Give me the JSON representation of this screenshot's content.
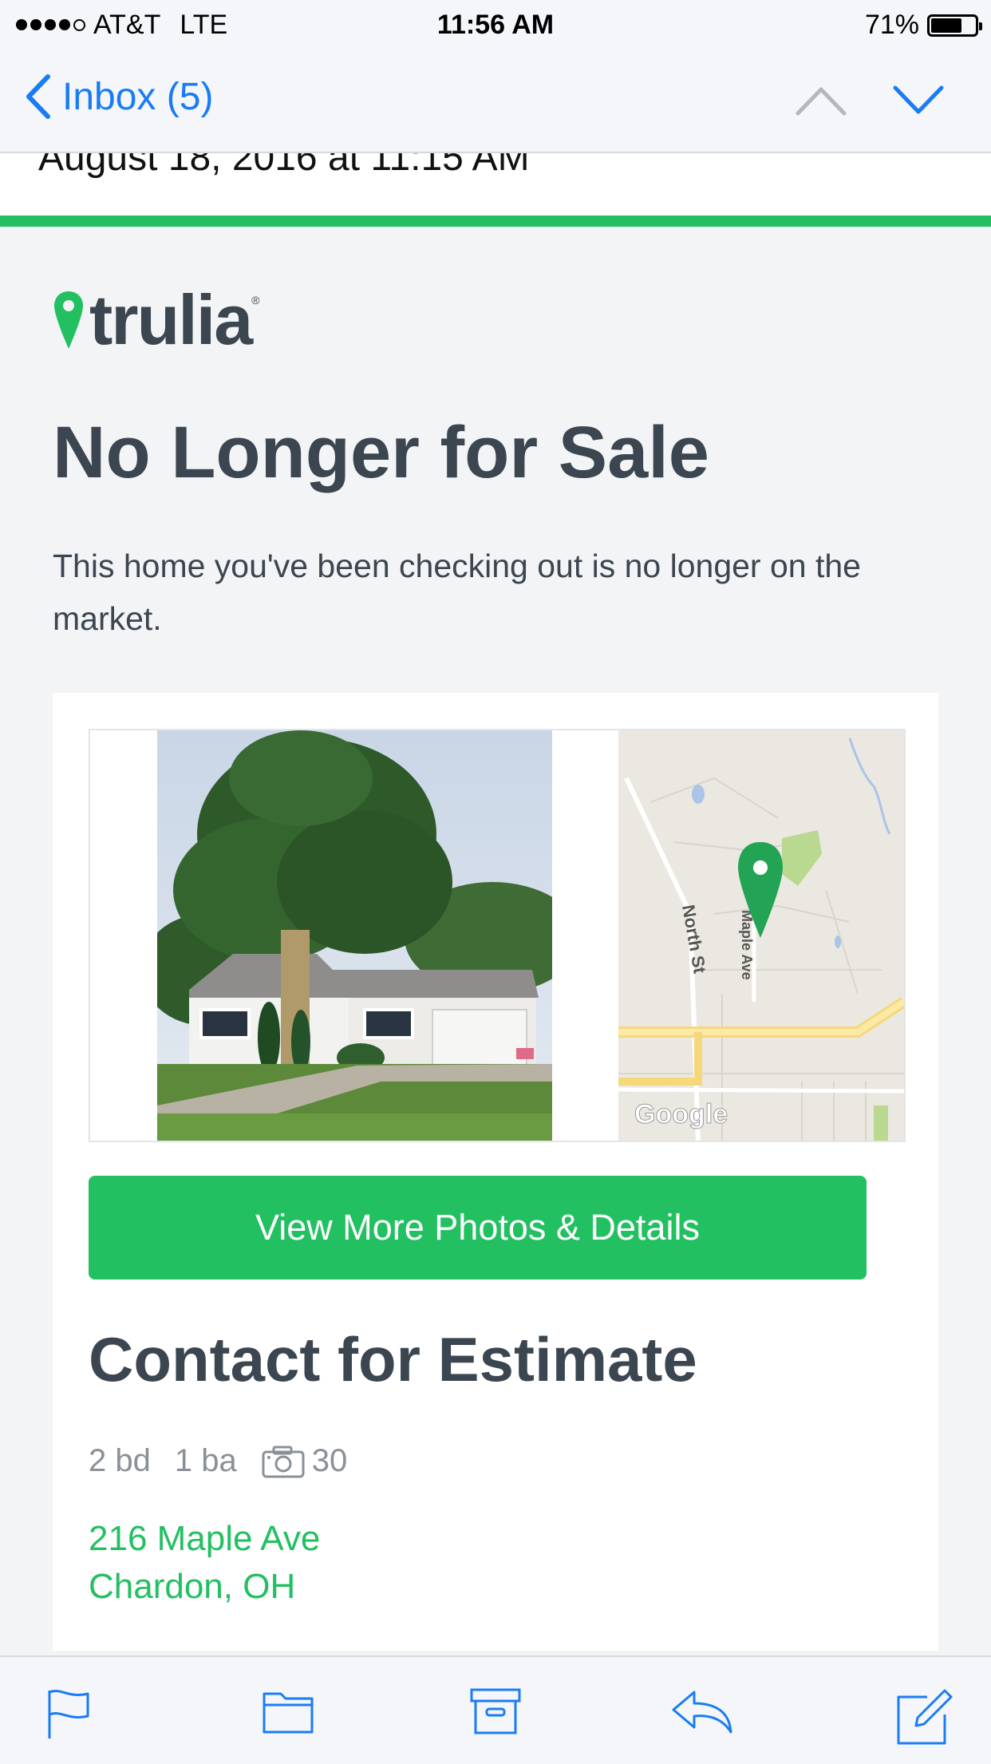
{
  "status_bar": {
    "carrier": "AT&T",
    "network": "LTE",
    "time": "11:56 AM",
    "battery": "71%",
    "battery_level": 0.71,
    "signal_bars": 4
  },
  "nav": {
    "back_label": "Inbox (5)"
  },
  "email": {
    "date": "August 18, 2016 at 11:15 AM",
    "brand": "trulia",
    "headline": "No Longer for Sale",
    "subtitle": "This home you've been checking out is no longer on the market.",
    "map": {
      "street_1": "North St",
      "street_2": "Maple Ave",
      "watermark": "Google"
    },
    "cta_label": "View More Photos & Details",
    "price": "Contact for Estimate",
    "beds": "2 bd",
    "baths": "1 ba",
    "photos": "30",
    "address_line1": "216 Maple Ave",
    "address_line2": "Chardon, OH"
  },
  "colors": {
    "accent_green": "#23c062",
    "ios_blue": "#1a7cf5",
    "text_dark": "#3c4650"
  },
  "toolbar": {
    "icons": [
      "flag-icon",
      "folder-icon",
      "archive-icon",
      "reply-icon",
      "compose-icon"
    ]
  }
}
